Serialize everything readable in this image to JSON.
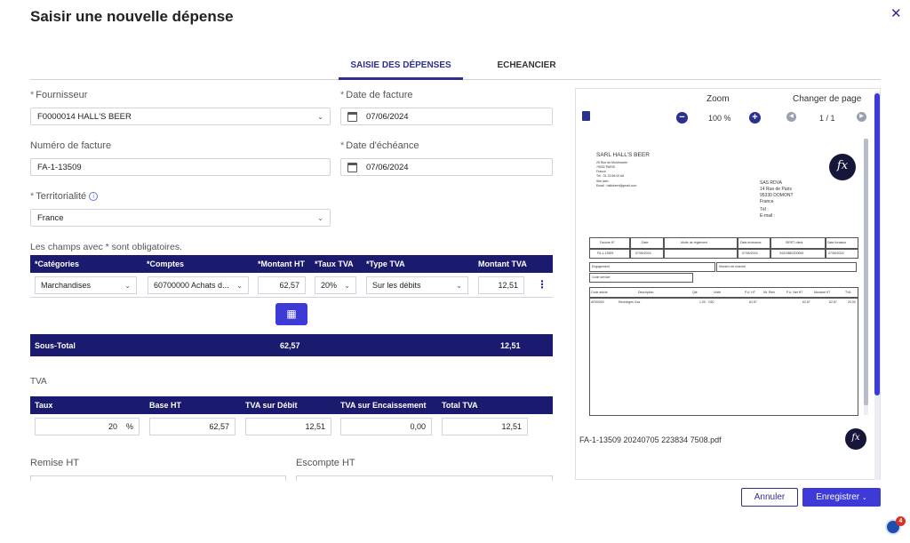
{
  "title": "Saisir une nouvelle dépense",
  "tabs": [
    {
      "label": "SAISIE DES DÉPENSES",
      "active": true
    },
    {
      "label": "ECHEANCIER",
      "active": false
    }
  ],
  "form": {
    "supplier_label": "Fournisseur",
    "supplier_value": "F0000014 HALL'S BEER",
    "invoice_date_label": "Date de facture",
    "invoice_date_value": "07/06/2024",
    "invoice_number_label": "Numéro de facture",
    "invoice_number_value": "FA-1-13509",
    "due_date_label": "Date d'échéance",
    "due_date_value": "07/06/2024",
    "territoriality_label": "Territorialité",
    "territoriality_value": "France",
    "required_note": "Les champs avec * sont obligatoires."
  },
  "lines_table": {
    "headers": [
      "Catégories",
      "Comptes",
      "Montant HT",
      "Taux TVA",
      "Type TVA",
      "Montant TVA"
    ],
    "row": {
      "category": "Marchandises",
      "account": "60700000 Achats d...",
      "amount_ht": "62,57",
      "vat_rate": "20%",
      "vat_type": "Sur les débits",
      "vat_amount": "12,51"
    },
    "subtotal": {
      "label": "Sous-Total",
      "amount_ht": "62,57",
      "vat_amount": "12,51"
    }
  },
  "tva": {
    "section_label": "TVA",
    "headers": [
      "Taux",
      "Base HT",
      "TVA sur Débit",
      "TVA sur Encaissement",
      "Total TVA"
    ],
    "row": {
      "rate": "20",
      "rate_unit": "%",
      "base_ht": "62,57",
      "debit": "12,51",
      "encaissement": "0,00",
      "total": "12,51"
    }
  },
  "remise_label": "Remise HT",
  "escompte_label": "Escompte HT",
  "viewer": {
    "zoom_label": "Zoom",
    "zoom_value": "100 %",
    "page_label": "Changer de page",
    "page_value": "1 / 1",
    "filename": "FA-1-13509 20240705 223834 7508.pdf",
    "doc": {
      "sender": "SARL HALL'S BEER",
      "sender_lines": [
        "25 Rue de Montmartre",
        "75002 PARIS",
        "France",
        "Tél : 01 33 86 00 66",
        "Site web :",
        "Email : hallsbeer@gmail.com"
      ],
      "recipient_lines": [
        "SAS RDVA",
        "14 Rue de Paris",
        "95330 DOMONT",
        "France",
        "Tél :",
        "E-mail :"
      ],
      "table1_headers": [
        "Facture N°",
        "Date",
        "Mode de règlement",
        "Date échéance",
        "SIRET client",
        "Date livraison"
      ],
      "table1_values": [
        "FA-1-13509",
        "07/06/2024",
        "",
        "07/06/2024",
        "34319882200063",
        "07/06/2024"
      ],
      "engagement": "Engagement",
      "marche": "Numéro de marché",
      "code_service": "Code service",
      "table2_headers": [
        "Code article",
        "Description",
        "Qté",
        "Unité",
        "P.U. HT",
        "Mt. Rem",
        "P.U. Net HT",
        "Montant HT",
        "TVA"
      ],
      "table2_values": [
        "AR00003",
        "Recharges Gaz",
        "1,00",
        "C60",
        "62,57",
        "",
        "62,57",
        "62,57",
        "20,00"
      ]
    }
  },
  "buttons": {
    "cancel": "Annuler",
    "save": "Enregistrer"
  },
  "chat_badge": "4"
}
